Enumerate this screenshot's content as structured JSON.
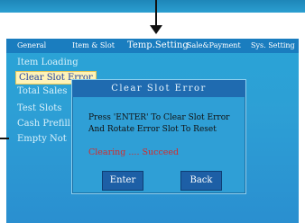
{
  "tabs": [
    {
      "label": "General"
    },
    {
      "label": "Item & Slot"
    },
    {
      "label": "Temp.Setting"
    },
    {
      "label": "Sale&Payment"
    },
    {
      "label": "Sys. Setting"
    }
  ],
  "menu": [
    {
      "label": "Item Loading"
    },
    {
      "label": "Clear Slot Error"
    },
    {
      "label": "Total Sales"
    },
    {
      "label": "Test Slots"
    },
    {
      "label": "Cash Prefill"
    },
    {
      "label": "Empty Not"
    }
  ],
  "dialog": {
    "title": "Clear Slot Error",
    "message_line1": "Press 'ENTER' To Clear Slot Error",
    "message_line2": "And Rotate Error Slot To Reset",
    "status": "Clearing .... Succeed",
    "enter_label": "Enter",
    "back_label": "Back"
  },
  "colors": {
    "screen_bg": "#2aa4d6",
    "tabbar_bg": "#1a7dbf",
    "selected_bg": "#fff3b8",
    "status_text": "#d42b2b"
  }
}
